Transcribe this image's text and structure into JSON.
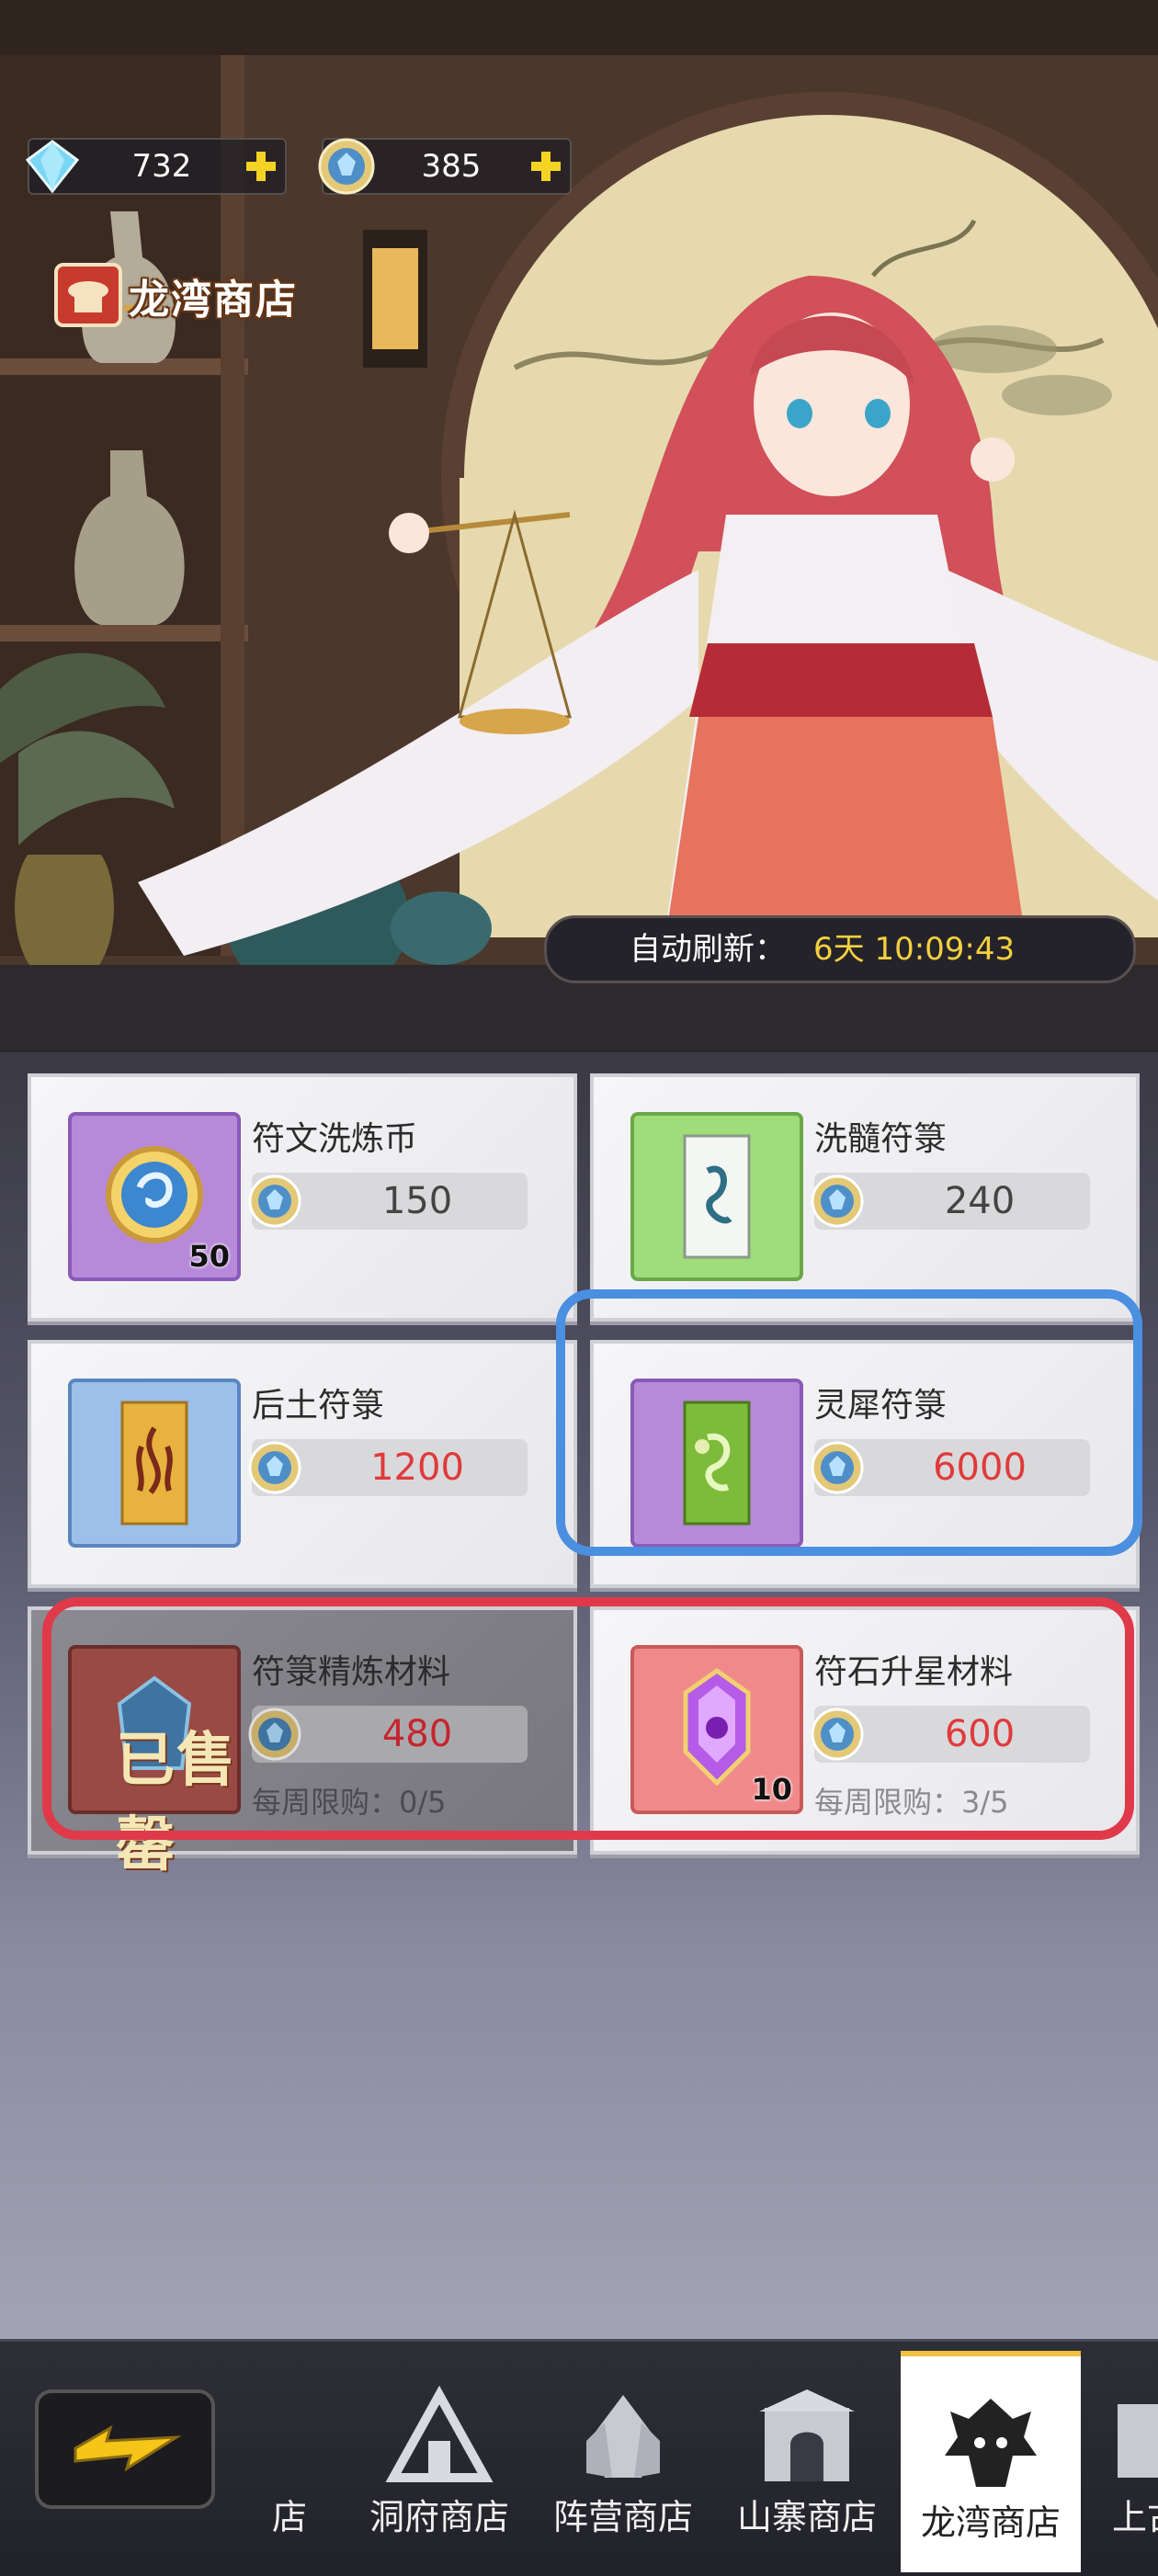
{
  "currency": {
    "diamonds": "732",
    "coins": "385"
  },
  "header": {
    "shop_title": "龙湾商店"
  },
  "refresh": {
    "label": "自动刷新：",
    "time": "6天 10:09:43"
  },
  "items": [
    {
      "name": "符文洗炼币",
      "price": "150",
      "quantity": "50",
      "price_color": "#444444",
      "icon": "rune-coin-icon",
      "frame": "purple"
    },
    {
      "name": "洗髓符箓",
      "price": "240",
      "quantity": "",
      "price_color": "#444444",
      "icon": "talisman-green-icon",
      "frame": "green"
    },
    {
      "name": "后土符箓",
      "price": "1200",
      "quantity": "",
      "price_color": "#e03a3a",
      "icon": "talisman-earth-icon",
      "frame": "blue"
    },
    {
      "name": "灵犀符箓",
      "price": "6000",
      "quantity": "",
      "price_color": "#e03a3a",
      "icon": "talisman-spirit-icon",
      "frame": "purple"
    },
    {
      "name": "符箓精炼材料",
      "price": "480",
      "quantity": "",
      "price_color": "#e03a3a",
      "limit": "每周限购：0/5",
      "sold_out": "已售罄",
      "icon": "refine-crystal-icon",
      "frame": "red"
    },
    {
      "name": "符石升星材料",
      "price": "600",
      "quantity": "10",
      "price_color": "#e03a3a",
      "limit": "每周限购：3/5",
      "icon": "star-crystal-icon",
      "frame": "red"
    }
  ],
  "tabs": [
    {
      "label": "店",
      "active": false
    },
    {
      "label": "洞府商店",
      "active": false
    },
    {
      "label": "阵营商店",
      "active": false
    },
    {
      "label": "山寨商店",
      "active": false
    },
    {
      "label": "龙湾商店",
      "active": true
    },
    {
      "label": "上古",
      "active": false
    }
  ],
  "colors": {
    "highlight_blue": "#4a8fe0",
    "highlight_red": "#e03a4a",
    "active_tab_accent": "#f0c040",
    "refresh_time": "#f4d03f"
  }
}
